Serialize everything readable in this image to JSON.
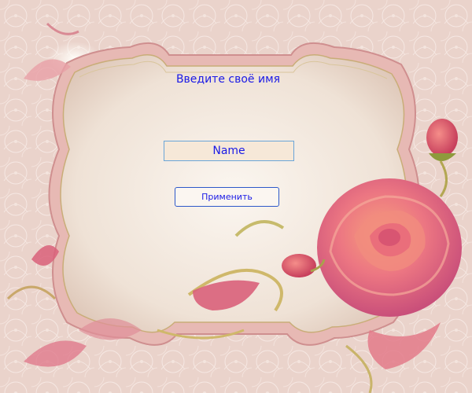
{
  "dialog": {
    "title": "Введите своё имя",
    "name_input": {
      "value": "Name"
    },
    "apply_label": "Применить"
  },
  "colors": {
    "text_accent": "#1a1ae6",
    "input_background": "#f6e8d8",
    "input_border": "#6aa5d8",
    "button_border": "#2d58c9",
    "rose_primary": "#e86c7c",
    "background_lace": "#e9cfc6"
  },
  "decor": {
    "background": "lace-pattern",
    "frame": "ornate-cream-frame",
    "flower": "pink-rose-with-buds"
  }
}
